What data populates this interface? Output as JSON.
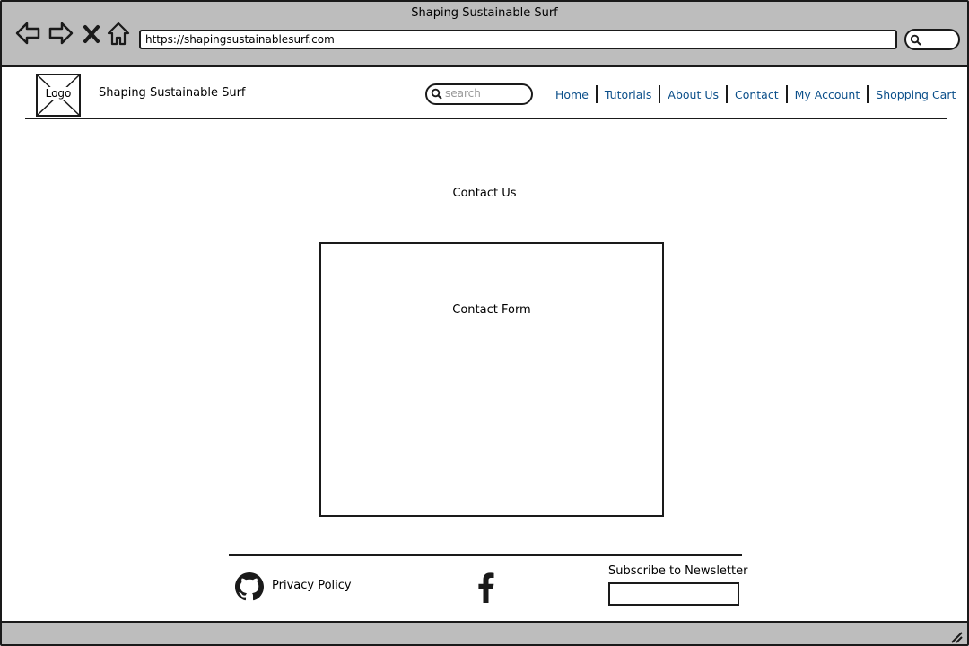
{
  "window": {
    "title": "Shaping Sustainable Surf"
  },
  "browser": {
    "url": "https://shapingsustainablesurf.com",
    "nav_icons": [
      "back-arrow-icon",
      "forward-arrow-icon",
      "stop-icon",
      "home-icon"
    ],
    "search_icon": "search-icon"
  },
  "header": {
    "logo_label": "Logo",
    "site_name": "Shaping Sustainable Surf",
    "search_placeholder": "search",
    "nav": {
      "home": "Home",
      "tutorials": "Tutorials",
      "about": "About Us",
      "contact": "Contact",
      "account": "My Account",
      "cart": "Shopping Cart"
    },
    "link_color": "#0b4f8a"
  },
  "main": {
    "heading": "Contact Us",
    "form_label": "Contact Form"
  },
  "footer": {
    "privacy": "Privacy Policy",
    "github_icon": "github-icon",
    "facebook_icon": "facebook-icon",
    "newsletter_label": "Subscribe to Newsletter"
  },
  "colors": {
    "chrome_bg": "#bdbdbd",
    "stroke": "#1a1a1a"
  }
}
